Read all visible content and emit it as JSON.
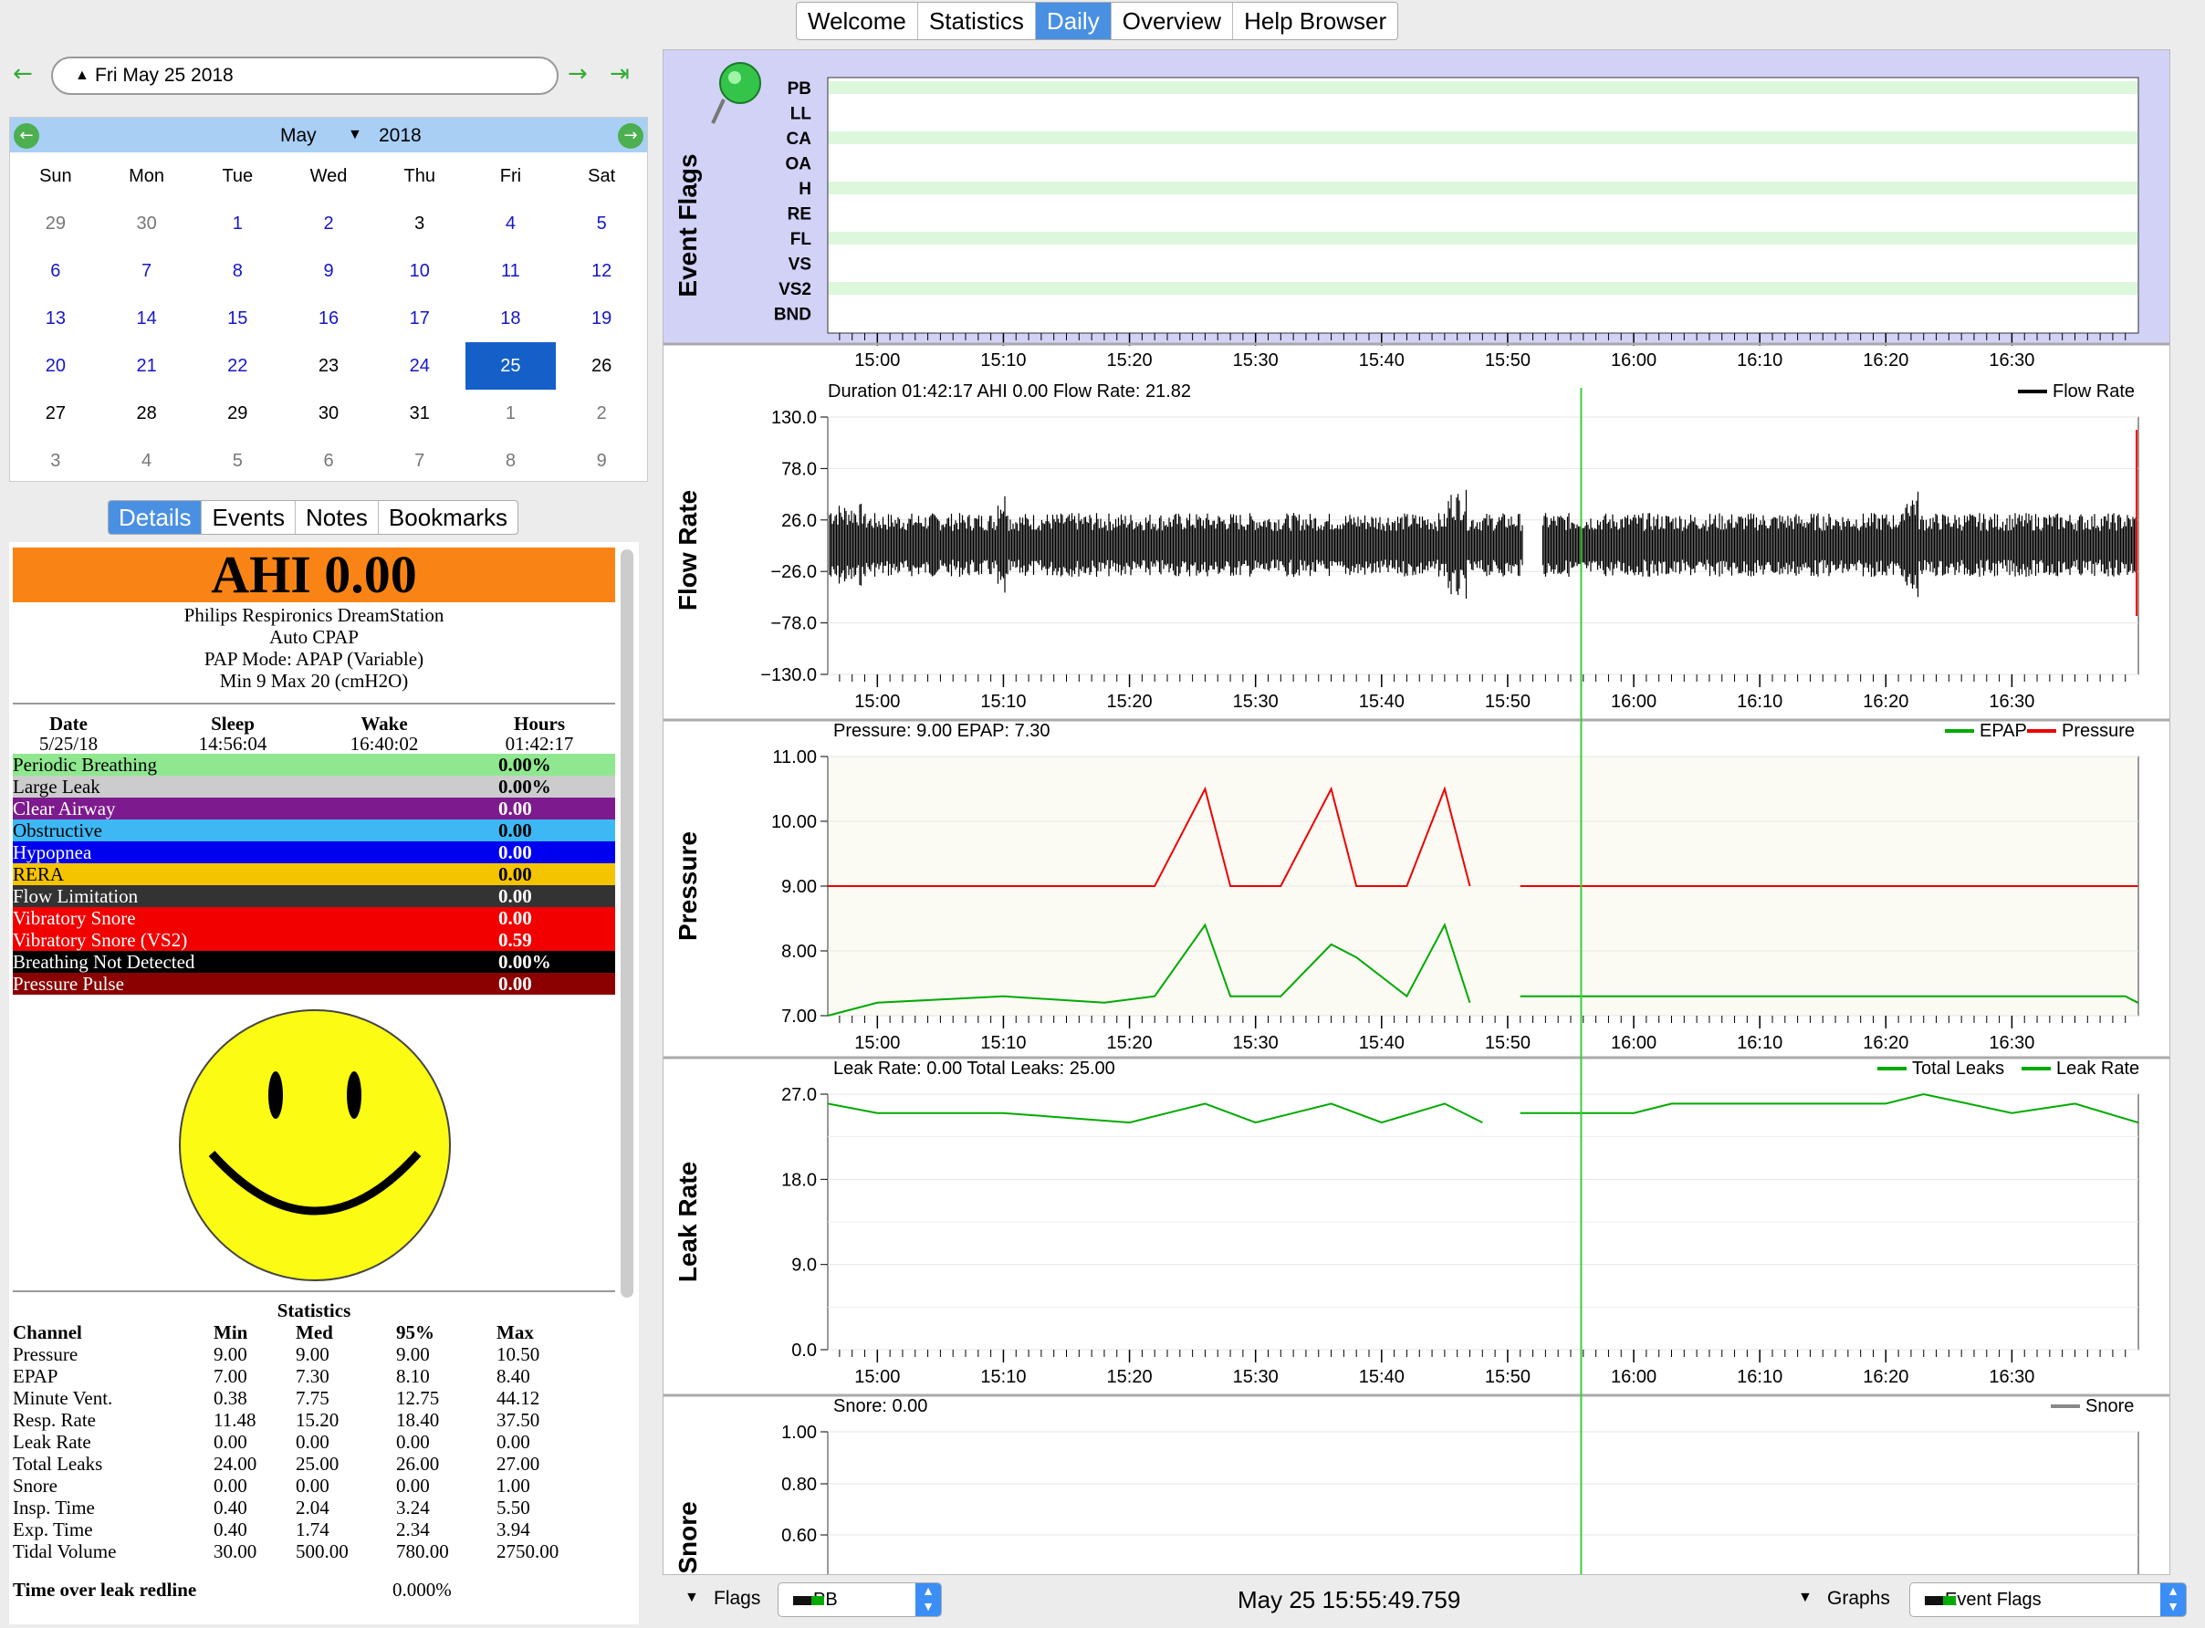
{
  "tabs": [
    "Welcome",
    "Statistics",
    "Daily",
    "Overview",
    "Help Browser"
  ],
  "date_nav": {
    "current": "Fri May 25 2018"
  },
  "calendar": {
    "month": "May",
    "year": "2018",
    "weekdays": [
      "Sun",
      "Mon",
      "Tue",
      "Wed",
      "Thu",
      "Fri",
      "Sat"
    ],
    "weeks": [
      [
        "29",
        "30",
        "1",
        "2",
        "3",
        "4",
        "5"
      ],
      [
        "6",
        "7",
        "8",
        "9",
        "10",
        "11",
        "12"
      ],
      [
        "13",
        "14",
        "15",
        "16",
        "17",
        "18",
        "19"
      ],
      [
        "20",
        "21",
        "22",
        "23",
        "24",
        "25",
        "26"
      ],
      [
        "27",
        "28",
        "29",
        "30",
        "31",
        "1",
        "2"
      ],
      [
        "3",
        "4",
        "5",
        "6",
        "7",
        "8",
        "9"
      ]
    ],
    "selected": "25"
  },
  "detail_tabs": [
    "Details",
    "Events",
    "Notes",
    "Bookmarks"
  ],
  "details": {
    "ahi": "AHI 0.00",
    "device": [
      "Philips Respironics DreamStation",
      "Auto CPAP",
      "PAP Mode: APAP (Variable)",
      "Min 9 Max 20 (cmH2O)"
    ],
    "hdr": {
      "date_label": "Date",
      "date": "5/25/18",
      "sleep_label": "Sleep",
      "sleep": "14:56:04",
      "wake_label": "Wake",
      "wake": "16:40:02",
      "hours_label": "Hours",
      "hours": "01:42:17"
    },
    "events": [
      {
        "name": "Periodic Breathing",
        "value": "0.00%",
        "bg": "#8fe88f",
        "fg": "#000"
      },
      {
        "name": "Large Leak",
        "value": "0.00%",
        "bg": "#cccccc",
        "fg": "#000"
      },
      {
        "name": "Clear Airway",
        "value": "0.00",
        "bg": "#7d1a8d",
        "fg": "#fff"
      },
      {
        "name": "Obstructive",
        "value": "0.00",
        "bg": "#3db8f5",
        "fg": "#000"
      },
      {
        "name": "Hypopnea",
        "value": "0.00",
        "bg": "#0000f0",
        "fg": "#fff"
      },
      {
        "name": "RERA",
        "value": "0.00",
        "bg": "#f5c400",
        "fg": "#000"
      },
      {
        "name": "Flow Limitation",
        "value": "0.00",
        "bg": "#333333",
        "fg": "#fff"
      },
      {
        "name": "Vibratory Snore",
        "value": "0.00",
        "bg": "#f20000",
        "fg": "#fff"
      },
      {
        "name": "Vibratory Snore (VS2)",
        "value": "0.59",
        "bg": "#f20000",
        "fg": "#fff"
      },
      {
        "name": "Breathing Not Detected",
        "value": "0.00%",
        "bg": "#000000",
        "fg": "#fff"
      },
      {
        "name": "Pressure Pulse",
        "value": "0.00",
        "bg": "#8b0000",
        "fg": "#fff"
      }
    ],
    "stats_title": "Statistics",
    "stats_cols": [
      "Channel",
      "Min",
      "Med",
      "95%",
      "Max"
    ],
    "stats_rows": [
      [
        "Pressure",
        "9.00",
        "9.00",
        "9.00",
        "10.50"
      ],
      [
        "EPAP",
        "7.00",
        "7.30",
        "8.10",
        "8.40"
      ],
      [
        "Minute Vent.",
        "0.38",
        "7.75",
        "12.75",
        "44.12"
      ],
      [
        "Resp. Rate",
        "11.48",
        "15.20",
        "18.40",
        "37.50"
      ],
      [
        "Leak Rate",
        "0.00",
        "0.00",
        "0.00",
        "0.00"
      ],
      [
        "Total Leaks",
        "24.00",
        "25.00",
        "26.00",
        "27.00"
      ],
      [
        "Snore",
        "0.00",
        "0.00",
        "0.00",
        "1.00"
      ],
      [
        "Insp. Time",
        "0.40",
        "2.04",
        "3.24",
        "5.50"
      ],
      [
        "Exp. Time",
        "0.40",
        "1.74",
        "2.34",
        "3.94"
      ],
      [
        "Tidal Volume",
        "30.00",
        "500.00",
        "780.00",
        "2750.00"
      ]
    ],
    "leak_redline_label": "Time over leak redline",
    "leak_redline": "0.000%"
  },
  "time_ticks": [
    "15:00",
    "15:10",
    "15:20",
    "15:30",
    "15:40",
    "15:50",
    "16:00",
    "16:10",
    "16:20",
    "16:30"
  ],
  "charts": {
    "event_flags": {
      "title": "Event Flags",
      "rows": [
        "PB",
        "LL",
        "CA",
        "OA",
        "H",
        "RE",
        "FL",
        "VS",
        "VS2",
        "BND"
      ]
    },
    "flow_rate": {
      "title": "Flow Rate",
      "header": "Duration 01:42:17 AHI 0.00 Flow Rate: 21.82",
      "legend": [
        "Flow Rate"
      ],
      "yticks": [
        "130.0",
        "78.0",
        "26.0",
        "−26.0",
        "−78.0",
        "−130.0"
      ]
    },
    "pressure": {
      "title": "Pressure",
      "header": "Pressure: 9.00 EPAP: 7.30",
      "legend": [
        "EPAP",
        "Pressure"
      ],
      "yticks": [
        "11.00",
        "10.00",
        "9.00",
        "8.00",
        "7.00"
      ]
    },
    "leak_rate": {
      "title": "Leak Rate",
      "header": "Leak Rate: 0.00 Total Leaks: 25.00",
      "legend": [
        "Total Leaks",
        "Leak Rate"
      ],
      "yticks": [
        "27.0",
        "18.0",
        "9.0",
        "0.0"
      ]
    },
    "snore": {
      "title": "Snore",
      "header": "Snore: 0.00",
      "legend": [
        "Snore"
      ],
      "yticks": [
        "1.00",
        "0.80",
        "0.60"
      ]
    }
  },
  "chart_data": [
    {
      "type": "line",
      "title": "Pressure",
      "x": [
        "14:56",
        "15:00",
        "15:10",
        "15:18",
        "15:22",
        "15:26",
        "15:28",
        "15:32",
        "15:36",
        "15:38",
        "15:42",
        "15:45",
        "15:47",
        "15:51",
        "16:00",
        "16:10",
        "16:20",
        "16:30",
        "16:39",
        "16:40"
      ],
      "series": [
        {
          "name": "Pressure",
          "values": [
            9,
            9,
            9,
            9,
            9,
            10.5,
            9,
            9,
            10.5,
            9,
            9,
            10.5,
            9,
            9,
            9,
            9,
            9,
            9,
            9,
            9
          ]
        },
        {
          "name": "EPAP",
          "values": [
            7,
            7.2,
            7.3,
            7.2,
            7.3,
            8.4,
            7.3,
            7.3,
            8.1,
            7.9,
            7.3,
            8.4,
            7.2,
            7.3,
            7.3,
            7.3,
            7.3,
            7.3,
            7.3,
            7.2
          ]
        }
      ],
      "ylim": [
        7,
        11
      ]
    },
    {
      "type": "line",
      "title": "Leak Rate",
      "x": [
        "14:56",
        "15:00",
        "15:10",
        "15:20",
        "15:26",
        "15:30",
        "15:36",
        "15:40",
        "15:45",
        "15:48",
        "15:51",
        "16:00",
        "16:03",
        "16:10",
        "16:20",
        "16:23",
        "16:30",
        "16:35",
        "16:40"
      ],
      "series": [
        {
          "name": "Total Leaks",
          "values": [
            26,
            25,
            25,
            24,
            26,
            24,
            26,
            24,
            26,
            24,
            25,
            25,
            26,
            26,
            26,
            27,
            25,
            26,
            24
          ]
        }
      ],
      "ylim": [
        0,
        27
      ]
    }
  ],
  "bottom": {
    "flags_label": "Flags",
    "flags_value": "PB",
    "time": "May 25 15:55:49.759",
    "graphs_label": "Graphs",
    "graphs_value": "Event Flags"
  }
}
